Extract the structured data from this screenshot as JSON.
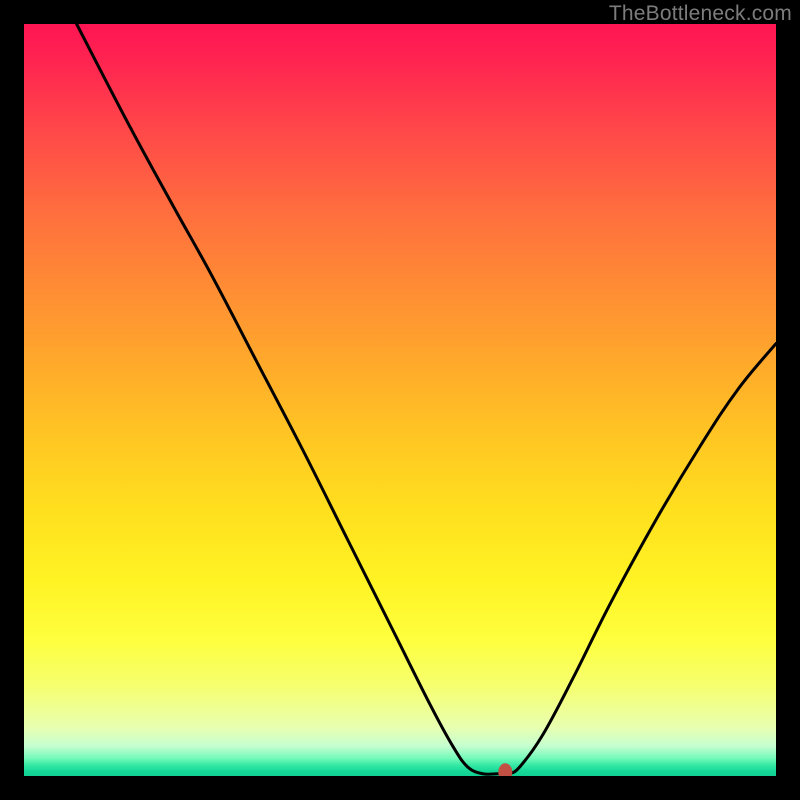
{
  "watermark": "TheBottleneck.com",
  "chart_data": {
    "type": "line",
    "title": "",
    "xlabel": "",
    "ylabel": "",
    "xlim": [
      0,
      100
    ],
    "ylim": [
      0,
      100
    ],
    "grid": false,
    "series": [
      {
        "name": "bottleneck-curve",
        "stroke": "#000000",
        "points": [
          {
            "x": 7.0,
            "y": 100.0
          },
          {
            "x": 14.0,
            "y": 86.5
          },
          {
            "x": 20.0,
            "y": 75.5
          },
          {
            "x": 25.0,
            "y": 66.5
          },
          {
            "x": 31.0,
            "y": 55.0
          },
          {
            "x": 37.0,
            "y": 43.5
          },
          {
            "x": 43.0,
            "y": 31.5
          },
          {
            "x": 49.0,
            "y": 19.5
          },
          {
            "x": 54.0,
            "y": 9.5
          },
          {
            "x": 57.0,
            "y": 4.0
          },
          {
            "x": 59.0,
            "y": 1.2
          },
          {
            "x": 61.0,
            "y": 0.3
          },
          {
            "x": 63.0,
            "y": 0.3
          },
          {
            "x": 64.5,
            "y": 0.3
          },
          {
            "x": 66.0,
            "y": 1.3
          },
          {
            "x": 69.0,
            "y": 5.5
          },
          {
            "x": 73.0,
            "y": 13.0
          },
          {
            "x": 78.0,
            "y": 23.0
          },
          {
            "x": 84.0,
            "y": 34.0
          },
          {
            "x": 90.0,
            "y": 44.0
          },
          {
            "x": 95.0,
            "y": 51.5
          },
          {
            "x": 100.0,
            "y": 57.5
          }
        ]
      }
    ],
    "marker": {
      "name": "optimal-point",
      "x": 64.0,
      "y": 0.5,
      "fill": "#c14f44",
      "rx": 7,
      "ry": 9
    },
    "background": {
      "type": "heatmap-vertical-gradient",
      "stops": [
        {
          "pos": 0.0,
          "color": "#ff1553"
        },
        {
          "pos": 0.5,
          "color": "#ffc623"
        },
        {
          "pos": 0.85,
          "color": "#feff3e"
        },
        {
          "pos": 1.0,
          "color": "#0fcf92"
        }
      ]
    }
  }
}
